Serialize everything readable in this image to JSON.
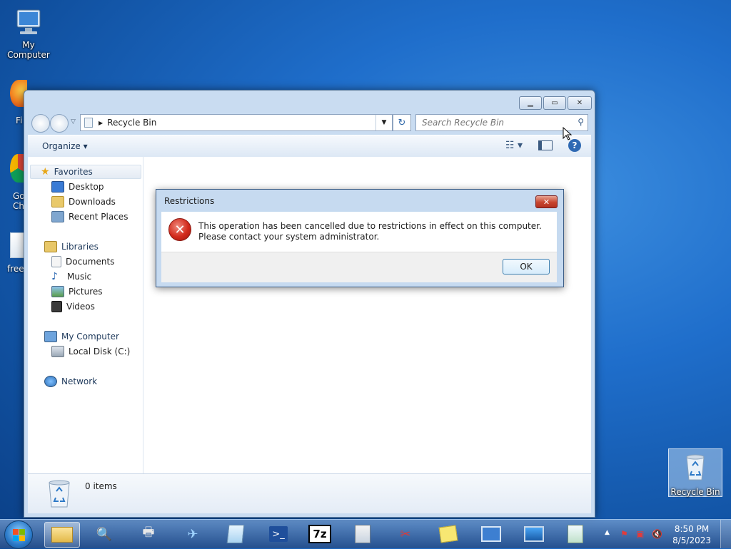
{
  "desktop": {
    "icons": {
      "my_computer": "My Computer",
      "recycle_bin": "Recycle Bin"
    },
    "partial_labels": {
      "firefox": "Fi",
      "chrome_1": "Go",
      "chrome_2": "Ch",
      "free": "free"
    }
  },
  "explorer": {
    "address": "Recycle Bin",
    "search_placeholder": "Search Recycle Bin",
    "toolbar": {
      "organize": "Organize ▾"
    },
    "nav": {
      "favorites": "Favorites",
      "desktop": "Desktop",
      "downloads": "Downloads",
      "recent": "Recent Places",
      "libraries": "Libraries",
      "documents": "Documents",
      "music": "Music",
      "pictures": "Pictures",
      "videos": "Videos",
      "my_computer": "My Computer",
      "local_disk": "Local Disk (C:)",
      "network": "Network"
    },
    "status": "0 items"
  },
  "dialog": {
    "title": "Restrictions",
    "message": "This operation has been cancelled due to restrictions in effect on this computer. Please contact your system administrator.",
    "ok": "OK"
  },
  "taskbar": {
    "time": "8:50 PM",
    "date": "8/5/2023",
    "seven_zip": "7z"
  },
  "colors": {
    "desktop": "#1f6ecb",
    "error_red": "#d22a1c",
    "window_frame": "#c9dcf1"
  }
}
